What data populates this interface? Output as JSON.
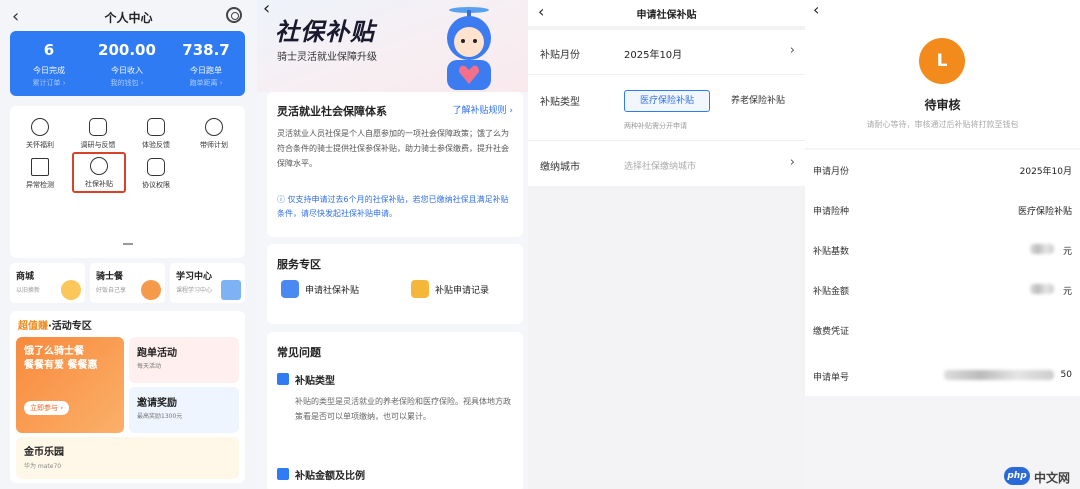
{
  "panel1": {
    "title": "个人中心",
    "stats": [
      {
        "value": "6",
        "label": "今日完成",
        "sub": "累计订单 ›"
      },
      {
        "value": "200.00",
        "label": "今日收入",
        "sub": "我的钱包 ›"
      },
      {
        "value": "738.7",
        "label": "今日跑单",
        "sub": "跑单距离 ›"
      }
    ],
    "tools": [
      {
        "label": "关怀福利",
        "icon": "heart-icon"
      },
      {
        "label": "调研与反馈",
        "icon": "note-edit-icon"
      },
      {
        "label": "体验反馈",
        "icon": "edit-icon"
      },
      {
        "label": "带师计划",
        "icon": "user-plus-icon"
      },
      {
        "label": "异常检测",
        "icon": "warning-icon"
      },
      {
        "label": "社保补贴",
        "icon": "shield-icon"
      },
      {
        "label": "协议权限",
        "icon": "document-icon"
      }
    ],
    "cards": [
      {
        "title": "商城",
        "sub": "以旧换新"
      },
      {
        "title": "骑士餐",
        "sub": "好饭自己享"
      },
      {
        "title": "学习中心",
        "sub": "课程学习中心"
      }
    ],
    "activity": {
      "title_highlight": "超值赚",
      "title_rest": "·活动专区",
      "banner_line1": "饿了么骑士餐",
      "banner_line2": "餐餐有爱 餐餐惠",
      "banner_button": "立即参与 ›",
      "sub1_title": "跑单活动",
      "sub1_sub": "每天活动",
      "sub2_title": "邀请奖励",
      "sub2_sub": "最高奖励1300元",
      "gold_title": "金币乐园",
      "gold_sub": "华为 mate70"
    }
  },
  "panel2": {
    "hero_title": "社保补贴",
    "hero_sub": "骑士灵活就业保障升级",
    "section1_title": "灵活就业社会保障体系",
    "section1_link": "了解补贴规则 ›",
    "section1_body": "灵活就业人员社保是个人自愿参加的一项社会保障政策；饿了么为符合条件的骑士提供社保参保补贴，助力骑士参保缴费，提升社会保障水平。",
    "section1_note": "ⓘ 仅支持申请过去6个月的社保补贴，若您已缴纳社保且满足补贴条件，请尽快发起社保补贴申请。",
    "service_title": "服务专区",
    "service_apply": "申请社保补贴",
    "service_records": "补贴申请记录",
    "faq_title": "常见问题",
    "faq1_title": "补贴类型",
    "faq1_body": "补贴的类型是灵活就业的养老保险和医疗保险。视具体地方政策看是否可以单项缴纳，也可以累计。",
    "faq2_title": "补贴金额及比例"
  },
  "panel3": {
    "title": "申请社保补贴",
    "month_label": "补贴月份",
    "month_value": "2025年10月",
    "type_label": "补贴类型",
    "type_selected": "医疗保险补贴",
    "type_other": "养老保险补贴",
    "type_hint": "两种补贴需分开申请",
    "city_label": "缴纳城市",
    "city_placeholder": "选择社保缴纳城市"
  },
  "panel4": {
    "avatar_letter": "L",
    "status": "待审核",
    "desc": "请耐心等待，审核通过后补贴将打款至钱包",
    "rows": [
      {
        "label": "申请月份",
        "value": "2025年10月"
      },
      {
        "label": "申请险种",
        "value": "医疗保险补贴"
      },
      {
        "label": "补贴基数",
        "value": "元"
      },
      {
        "label": "补贴金额",
        "value": "元"
      },
      {
        "label": "缴费凭证",
        "value": ""
      },
      {
        "label": "申请单号",
        "value": "50"
      }
    ]
  },
  "watermark": {
    "logo": "php",
    "text": "中文网"
  },
  "colors": {
    "accent": "#2f7bf3",
    "orange": "#f28a1c",
    "highlight_border": "#d9412a"
  }
}
